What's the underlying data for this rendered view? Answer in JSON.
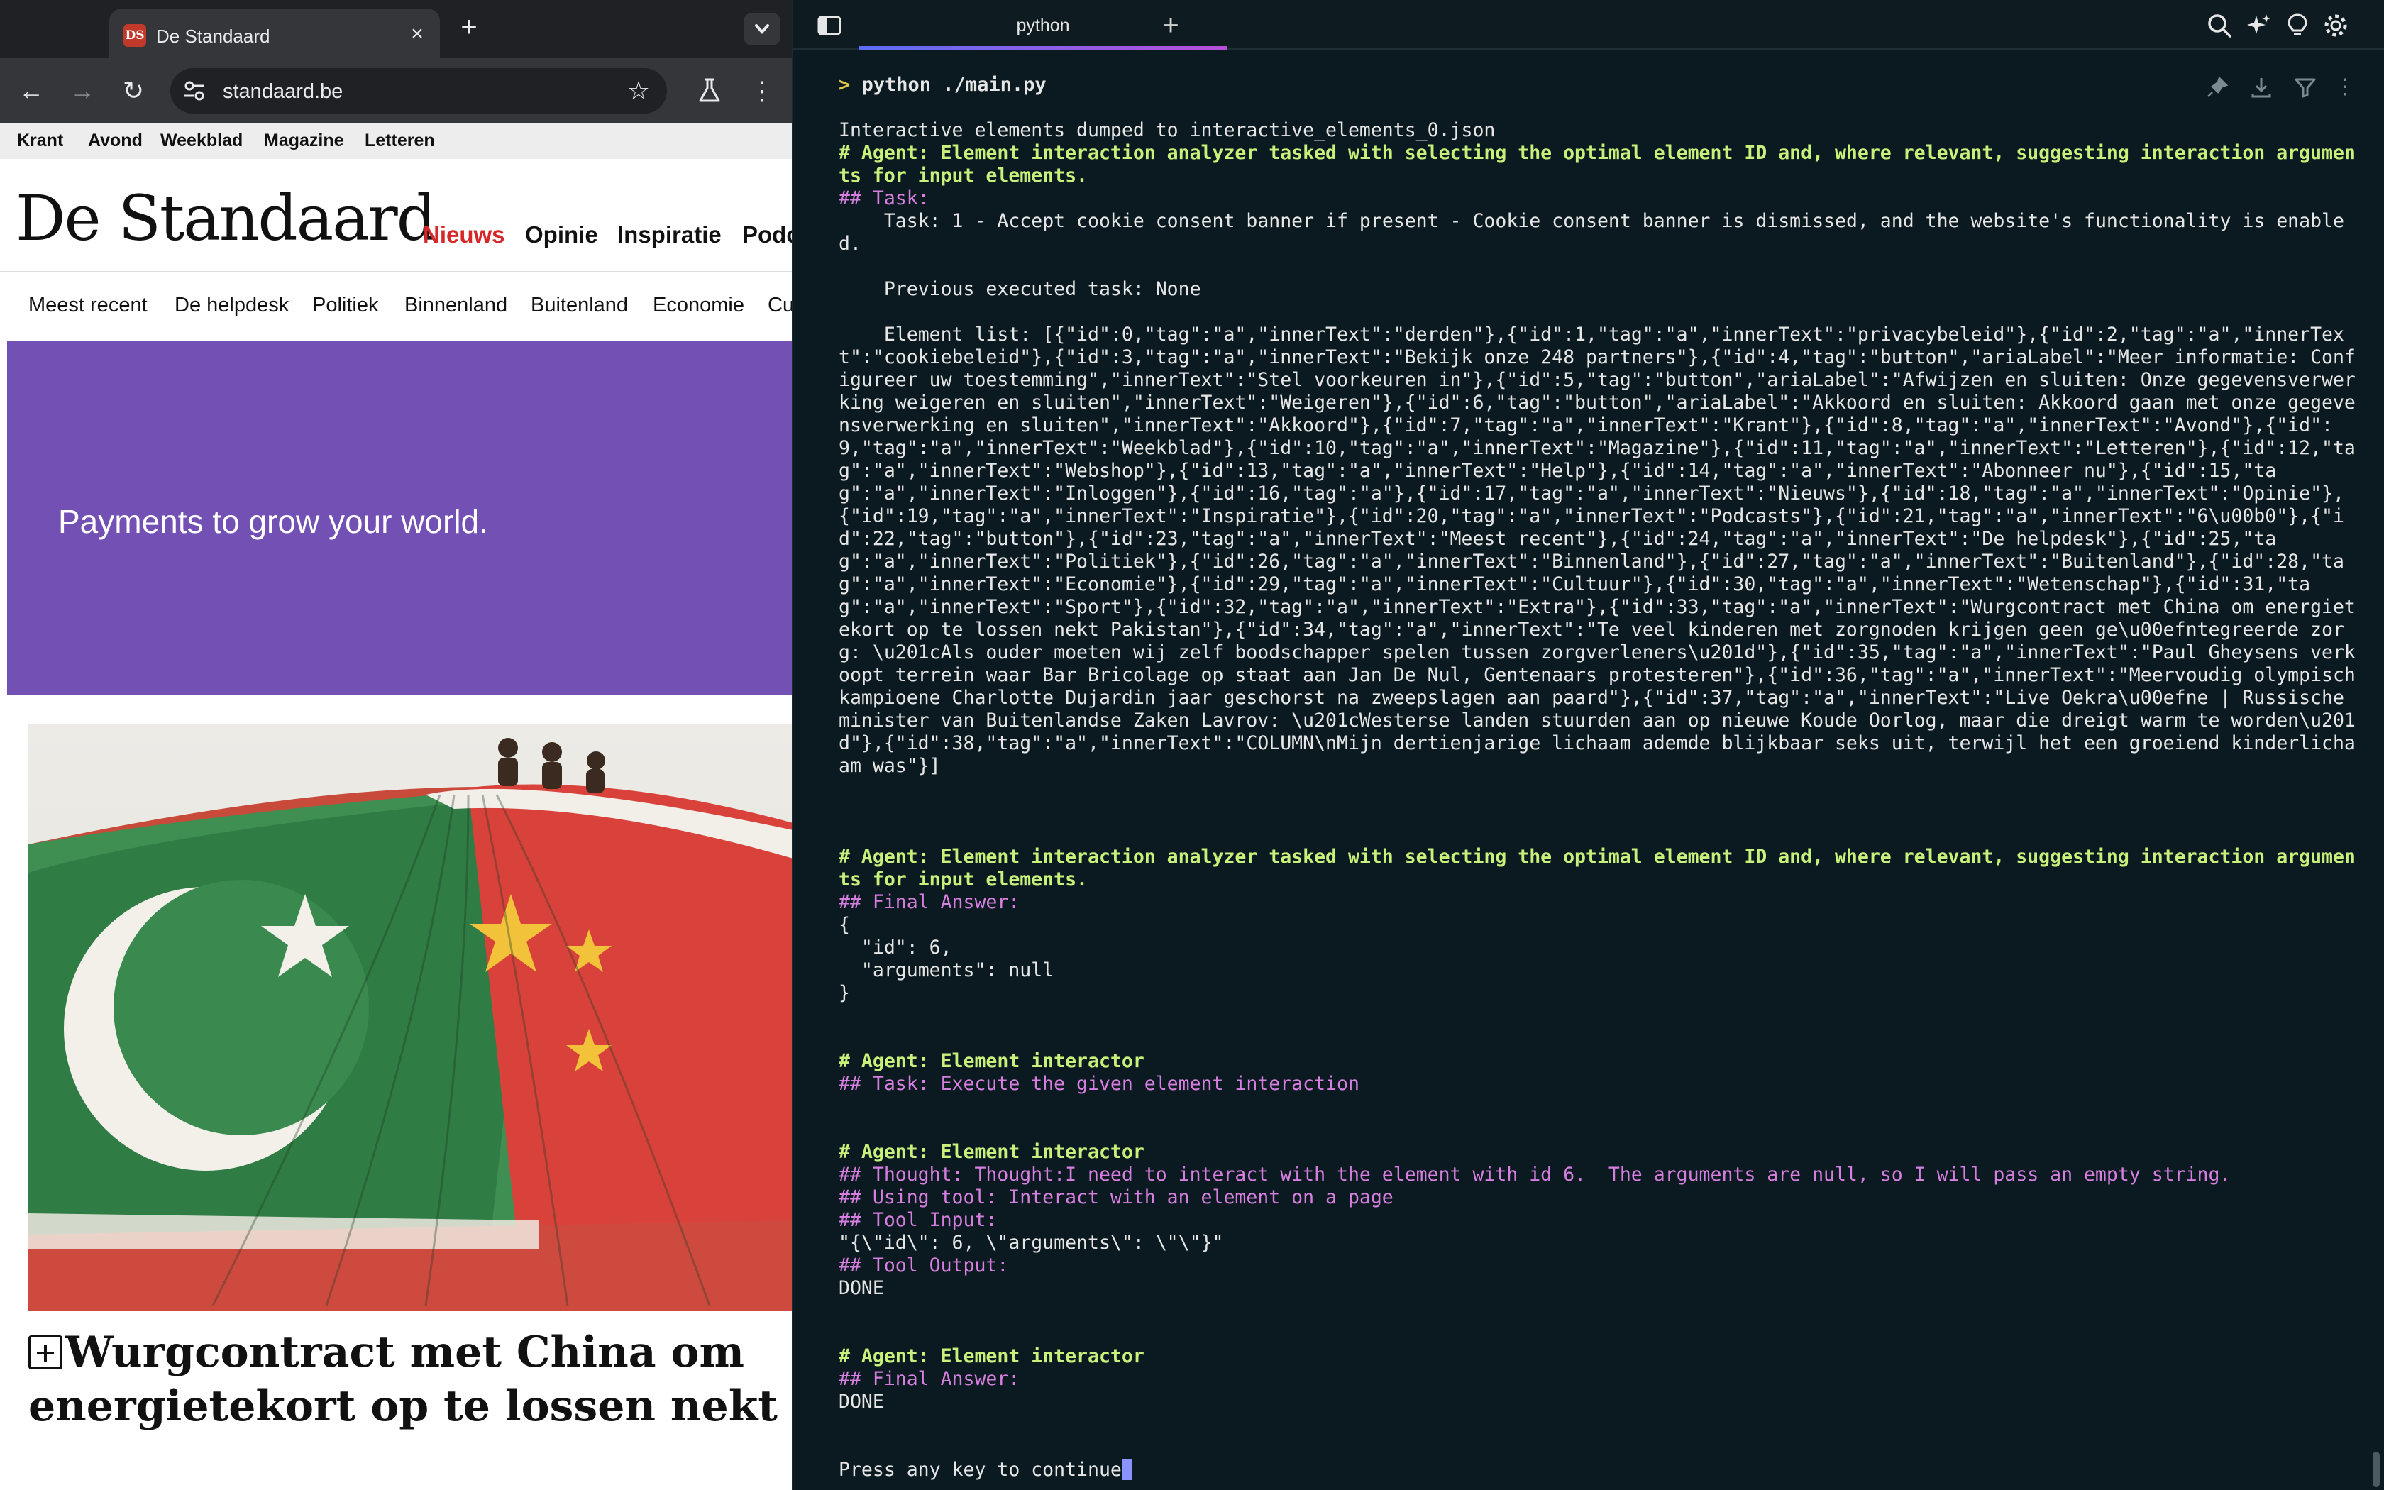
{
  "browser": {
    "tab_title": "De Standaard",
    "favicon_text": "DS",
    "url": "standaard.be",
    "top_nav": [
      "Krant",
      "Avond",
      "Weekblad",
      "Magazine",
      "Letteren"
    ],
    "logo": "De Standaard",
    "main_nav": [
      "Nieuws",
      "Opinie",
      "Inspiratie",
      "Podcasts"
    ],
    "sub_nav": [
      "Meest recent",
      "De helpdesk",
      "Politiek",
      "Binnenland",
      "Buitenland",
      "Economie",
      "Cultuur"
    ],
    "ad_text": "Payments to grow your world.",
    "headline": "Wurgcontract met China om energietekort op te lossen nekt Pakistan",
    "headline_line1": "Wurgcontract met China om",
    "headline_line2": "energietekort op te lossen nekt Pakistan"
  },
  "terminal": {
    "tab_label": "python",
    "command": "python ./main.py",
    "prompt_symbol": ">",
    "lines": [
      {
        "t": "text",
        "s": "Interactive elements dumped to interactive_elements_0.json"
      },
      {
        "t": "agent",
        "s": "# Agent: Element interaction analyzer tasked with selecting the optimal element ID and, where relevant, suggesting interaction arguments for input elements."
      },
      {
        "t": "hdr",
        "s": "## Task:"
      },
      {
        "t": "text",
        "s": "    Task: 1 - Accept cookie consent banner if present - Cookie consent banner is dismissed, and the website's functionality is enabled."
      },
      {
        "t": "text",
        "s": ""
      },
      {
        "t": "text",
        "s": "    Previous executed task: None"
      },
      {
        "t": "text",
        "s": ""
      },
      {
        "t": "text",
        "s": "    Element list: [{\"id\":0,\"tag\":\"a\",\"innerText\":\"derden\"},{\"id\":1,\"tag\":\"a\",\"innerText\":\"privacybeleid\"},{\"id\":2,\"tag\":\"a\",\"innerText\":\"cookiebeleid\"},{\"id\":3,\"tag\":\"a\",\"innerText\":\"Bekijk onze 248 partners\"},{\"id\":4,\"tag\":\"button\",\"ariaLabel\":\"Meer informatie: Configureer uw toestemming\",\"innerText\":\"Stel voorkeuren in\"},{\"id\":5,\"tag\":\"button\",\"ariaLabel\":\"Afwijzen en sluiten: Onze gegevensverwerking weigeren en sluiten\",\"innerText\":\"Weigeren\"},{\"id\":6,\"tag\":\"button\",\"ariaLabel\":\"Akkoord en sluiten: Akkoord gaan met onze gegevensverwerking en sluiten\",\"innerText\":\"Akkoord\"},{\"id\":7,\"tag\":\"a\",\"innerText\":\"Krant\"},{\"id\":8,\"tag\":\"a\",\"innerText\":\"Avond\"},{\"id\":9,\"tag\":\"a\",\"innerText\":\"Weekblad\"},{\"id\":10,\"tag\":\"a\",\"innerText\":\"Magazine\"},{\"id\":11,\"tag\":\"a\",\"innerText\":\"Letteren\"},{\"id\":12,\"tag\":\"a\",\"innerText\":\"Webshop\"},{\"id\":13,\"tag\":\"a\",\"innerText\":\"Help\"},{\"id\":14,\"tag\":\"a\",\"innerText\":\"Abonneer nu\"},{\"id\":15,\"tag\":\"a\",\"innerText\":\"Inloggen\"},{\"id\":16,\"tag\":\"a\"},{\"id\":17,\"tag\":\"a\",\"innerText\":\"Nieuws\"},{\"id\":18,\"tag\":\"a\",\"innerText\":\"Opinie\"},{\"id\":19,\"tag\":\"a\",\"innerText\":\"Inspiratie\"},{\"id\":20,\"tag\":\"a\",\"innerText\":\"Podcasts\"},{\"id\":21,\"tag\":\"a\",\"innerText\":\"6\\u00b0\"},{\"id\":22,\"tag\":\"button\"},{\"id\":23,\"tag\":\"a\",\"innerText\":\"Meest recent\"},{\"id\":24,\"tag\":\"a\",\"innerText\":\"De helpdesk\"},{\"id\":25,\"tag\":\"a\",\"innerText\":\"Politiek\"},{\"id\":26,\"tag\":\"a\",\"innerText\":\"Binnenland\"},{\"id\":27,\"tag\":\"a\",\"innerText\":\"Buitenland\"},{\"id\":28,\"tag\":\"a\",\"innerText\":\"Economie\"},{\"id\":29,\"tag\":\"a\",\"innerText\":\"Cultuur\"},{\"id\":30,\"tag\":\"a\",\"innerText\":\"Wetenschap\"},{\"id\":31,\"tag\":\"a\",\"innerText\":\"Sport\"},{\"id\":32,\"tag\":\"a\",\"innerText\":\"Extra\"},{\"id\":33,\"tag\":\"a\",\"innerText\":\"Wurgcontract met China om energietekort op te lossen nekt Pakistan\"},{\"id\":34,\"tag\":\"a\",\"innerText\":\"Te veel kinderen met zorgnoden krijgen geen ge\\u00efntegreerde zorg: \\u201cAls ouder moeten wij zelf boodschapper spelen tussen zorgverleners\\u201d\"},{\"id\":35,\"tag\":\"a\",\"innerText\":\"Paul Gheysens verkoopt terrein waar Bar Bricolage op staat aan Jan De Nul, Gentenaars protesteren\"},{\"id\":36,\"tag\":\"a\",\"innerText\":\"Meervoudig olympisch kampioene Charlotte Dujardin jaar geschorst na zweepslagen aan paard\"},{\"id\":37,\"tag\":\"a\",\"innerText\":\"Live Oekra\\u00efne | Russische minister van Buitenlandse Zaken Lavrov: \\u201cWesterse landen stuurden aan op nieuwe Koude Oorlog, maar die dreigt warm te worden\\u201d\"},{\"id\":38,\"tag\":\"a\",\"innerText\":\"COLUMN\\nMijn dertienjarige lichaam ademde blijkbaar seks uit, terwijl het een groeiend kinderlichaam was\"}]"
      },
      {
        "t": "text",
        "s": ""
      },
      {
        "t": "text",
        "s": ""
      },
      {
        "t": "text",
        "s": ""
      },
      {
        "t": "agent",
        "s": "# Agent: Element interaction analyzer tasked with selecting the optimal element ID and, where relevant, suggesting interaction arguments for input elements."
      },
      {
        "t": "hdr",
        "s": "## Final Answer:"
      },
      {
        "t": "text",
        "s": "{"
      },
      {
        "t": "text",
        "s": "  \"id\": 6,"
      },
      {
        "t": "text",
        "s": "  \"arguments\": null"
      },
      {
        "t": "text",
        "s": "}"
      },
      {
        "t": "text",
        "s": ""
      },
      {
        "t": "text",
        "s": ""
      },
      {
        "t": "agent",
        "s": "# Agent: Element interactor"
      },
      {
        "t": "hdr",
        "s": "## Task: Execute the given element interaction"
      },
      {
        "t": "text",
        "s": ""
      },
      {
        "t": "text",
        "s": ""
      },
      {
        "t": "agent",
        "s": "# Agent: Element interactor"
      },
      {
        "t": "hdr",
        "s": "## Thought: Thought:I need to interact with the element with id 6.  The arguments are null, so I will pass an empty string."
      },
      {
        "t": "hdr",
        "s": "## Using tool: Interact with an element on a page"
      },
      {
        "t": "hdr",
        "s": "## Tool Input:"
      },
      {
        "t": "text",
        "s": "\"{\\\"id\\\": 6, \\\"arguments\\\": \\\"\\\"}\""
      },
      {
        "t": "hdr",
        "s": "## Tool Output:"
      },
      {
        "t": "text",
        "s": "DONE"
      },
      {
        "t": "text",
        "s": ""
      },
      {
        "t": "text",
        "s": ""
      },
      {
        "t": "agent",
        "s": "# Agent: Element interactor"
      },
      {
        "t": "hdr",
        "s": "## Final Answer:"
      },
      {
        "t": "text",
        "s": "DONE"
      },
      {
        "t": "text",
        "s": ""
      },
      {
        "t": "text",
        "s": ""
      },
      {
        "t": "prompt",
        "s": "Press any key to continue"
      }
    ]
  },
  "colors": {
    "terminal_bg": "#0b1a20",
    "agent_green": "#c8f07a",
    "header_magenta": "#d77fe0",
    "nav_active_red": "#d62828",
    "ad_purple": "#7351b4"
  },
  "icons": [
    "back-arrow-icon",
    "forward-arrow-icon",
    "reload-icon",
    "site-info-icon",
    "star-icon",
    "labs-flask-icon",
    "kebab-menu-icon",
    "search-icon",
    "sparkle-icon",
    "lightbulb-icon",
    "gear-icon",
    "pin-icon",
    "download-icon",
    "filter-icon"
  ]
}
